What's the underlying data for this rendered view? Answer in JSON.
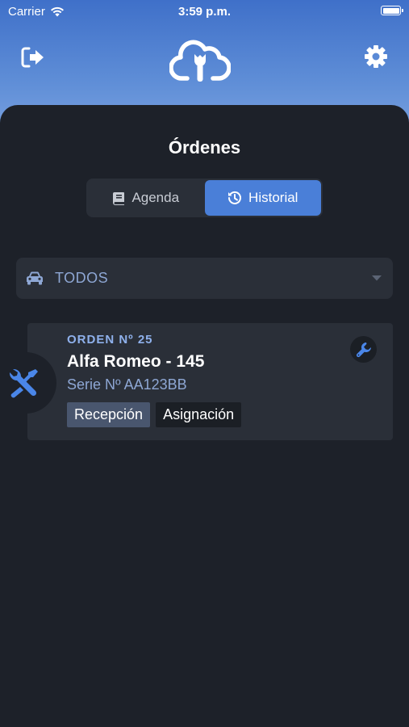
{
  "status_bar": {
    "carrier": "Carrier",
    "time": "3:59 p.m."
  },
  "header": {
    "left_icon": "logout-icon",
    "logo_icon": "cloud-wrench-icon",
    "right_icon": "gear-icon"
  },
  "page": {
    "title": "Órdenes"
  },
  "tabs": [
    {
      "label": "Agenda",
      "icon": "book-icon",
      "selected": false
    },
    {
      "label": "Historial",
      "icon": "history-icon",
      "selected": true
    }
  ],
  "filter": {
    "icon": "car-icon",
    "selected": "TODOS"
  },
  "orders": [
    {
      "number": "ORDEN Nº 25",
      "vehicle": "Alfa Romeo - 145",
      "serial": "Serie Nº AA123BB",
      "stages": [
        "Recepción",
        "Asignación"
      ],
      "current_stage": "Recepción",
      "badge_icon": "tools-icon",
      "action_icon": "wrench-icon"
    }
  ],
  "colors": {
    "header_gradient_top": "#3f70c9",
    "header_gradient_bottom": "#7aa2e0",
    "panel_bg": "#1d2129",
    "surface": "#2a2f38",
    "accent": "#4a7fd8",
    "accent_text": "#8fb1ec"
  }
}
